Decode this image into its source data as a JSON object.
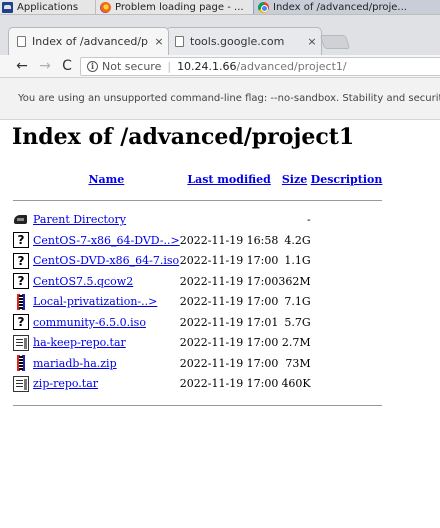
{
  "taskbar": {
    "apps_label": "Applications",
    "window_firefox": "Problem loading page - ...",
    "window_chrome": "Index of /advanced/proje..."
  },
  "tabs": [
    {
      "title": "Index of /advanced/p",
      "close": "×"
    },
    {
      "title": "tools.google.com",
      "close": "×"
    }
  ],
  "toolbar": {
    "back": "←",
    "forward": "→",
    "reload": "C",
    "info_icon": "i",
    "security": "Not secure",
    "separator": "|",
    "url_host": "10.24.1.66",
    "url_path": "/advanced/project1/"
  },
  "infobar": {
    "message": "You are using an unsupported command-line flag: --no-sandbox. Stability and security will suffer."
  },
  "page": {
    "title": "Index of /advanced/project1",
    "columns": {
      "name": "Name",
      "modified": "Last modified",
      "size": "Size",
      "description": "Description"
    },
    "rows": [
      {
        "icon": "back-icon",
        "name": "Parent Directory",
        "modified": "",
        "size": "-"
      },
      {
        "icon": "unknown-file-icon",
        "name": "CentOS-7-x86_64-DVD-..>",
        "modified": "2022-11-19 16:58",
        "size": "4.2G"
      },
      {
        "icon": "unknown-file-icon",
        "name": "CentOS-DVD-x86_64-7.iso",
        "modified": "2022-11-19 17:00",
        "size": "1.1G"
      },
      {
        "icon": "unknown-file-icon",
        "name": "CentOS7.5.qcow2",
        "modified": "2022-11-19 17:00",
        "size": "362M"
      },
      {
        "icon": "compressed-file-icon",
        "name": "Local-privatization-..>",
        "modified": "2022-11-19 17:00",
        "size": "7.1G"
      },
      {
        "icon": "unknown-file-icon",
        "name": "community-6.5.0.iso",
        "modified": "2022-11-19 17:01",
        "size": "5.7G"
      },
      {
        "icon": "text-file-icon",
        "name": "ha-keep-repo.tar",
        "modified": "2022-11-19 17:00",
        "size": "2.7M"
      },
      {
        "icon": "compressed-file-icon",
        "name": "mariadb-ha.zip",
        "modified": "2022-11-19 17:00",
        "size": "73M"
      },
      {
        "icon": "text-file-icon",
        "name": "zip-repo.tar",
        "modified": "2022-11-19 17:00",
        "size": "460K"
      }
    ]
  }
}
